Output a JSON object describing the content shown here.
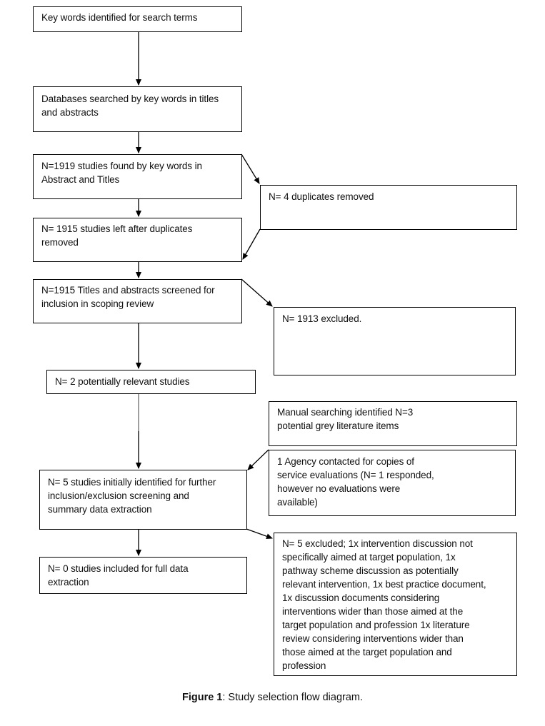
{
  "diagram": {
    "type": "flowchart",
    "title": "Study selection flow diagram",
    "main_flow": [
      {
        "id": "b1",
        "text": "Key words identified for search terms"
      },
      {
        "id": "b2",
        "text": "Databases searched by key words in titles and abstracts"
      },
      {
        "id": "b3",
        "text": "N=1919 studies found by key words in Abstract and Titles"
      },
      {
        "id": "b4",
        "text": "N= 1915 studies left after duplicates removed"
      },
      {
        "id": "b5",
        "text": "N=1915 Titles and abstracts screened for inclusion in scoping review"
      },
      {
        "id": "b6",
        "text": "N= 2 potentially relevant studies"
      },
      {
        "id": "b7",
        "text": "N= 5 studies initially identified for further inclusion/exclusion screening and summary data extraction"
      },
      {
        "id": "b8",
        "text": "N= 0 studies included for full data extraction"
      }
    ],
    "side_boxes": [
      {
        "id": "r1",
        "text": "N= 4 duplicates removed"
      },
      {
        "id": "r2",
        "text": "N= 1913 excluded."
      },
      {
        "id": "r3",
        "text": "Manual searching identified N=3 potential grey literature items"
      },
      {
        "id": "r4",
        "text": "1 Agency contacted for copies of service evaluations (N= 1 responded, however no evaluations were available)"
      },
      {
        "id": "r5",
        "text": "N= 5 excluded; 1x intervention discussion not specifically aimed at target population, 1x pathway scheme discussion as potentially relevant intervention, 1x best practice document, 1x discussion documents considering interventions wider than those aimed at the target population and profession  1x literature review considering interventions wider than those aimed at the target population and profession"
      }
    ],
    "edges": [
      {
        "from": "b1",
        "to": "b2"
      },
      {
        "from": "b2",
        "to": "b3"
      },
      {
        "from": "b3",
        "to": "r1"
      },
      {
        "from": "r1",
        "to": "b4"
      },
      {
        "from": "b3",
        "to": "b4"
      },
      {
        "from": "b4",
        "to": "b5"
      },
      {
        "from": "b5",
        "to": "r2"
      },
      {
        "from": "b5",
        "to": "b6"
      },
      {
        "from": "b6",
        "to": "b7"
      },
      {
        "from": "r4",
        "to": "b7"
      },
      {
        "from": "b7",
        "to": "r5"
      },
      {
        "from": "b7",
        "to": "b8"
      }
    ]
  },
  "boxes": {
    "b1": [
      "Key words identified for search terms"
    ],
    "b2": [
      "Databases searched by key words in titles",
      "and abstracts"
    ],
    "b3": [
      "N=1919 studies found by key words in",
      "Abstract and Titles"
    ],
    "b4": [
      "N= 1915 studies left after duplicates",
      "removed"
    ],
    "b5": [
      "N=1915 Titles and abstracts screened for",
      "inclusion in scoping review"
    ],
    "b6": [
      "N= 2 potentially relevant studies"
    ],
    "b7": [
      "N= 5 studies initially identified for further",
      "inclusion/exclusion screening and",
      "summary data extraction"
    ],
    "b8": [
      "N= 0 studies included for full data",
      "extraction"
    ],
    "r1": [
      "N= 4 duplicates removed"
    ],
    "r2": [
      "N= 1913 excluded."
    ],
    "r3": [
      "Manual searching identified N=3",
      "potential grey literature items"
    ],
    "r4": [
      "1 Agency contacted for copies of",
      "service evaluations (N= 1 responded,",
      "however no evaluations were",
      "available)"
    ],
    "r5": [
      "N= 5 excluded; 1x intervention discussion not",
      "specifically aimed at target population, 1x",
      "pathway scheme discussion as potentially",
      "relevant intervention, 1x best practice document,",
      "1x discussion documents considering",
      "interventions wider than those aimed at the",
      "target population and profession  1x literature",
      "review considering interventions wider than",
      "those aimed at the target population and",
      "profession"
    ]
  },
  "caption": {
    "label": "Figure 1",
    "text": ": Study selection flow diagram."
  },
  "colors": {
    "line": "#000000",
    "line_grey": "#7f7f7f",
    "text": "#111111",
    "background": "#ffffff"
  }
}
